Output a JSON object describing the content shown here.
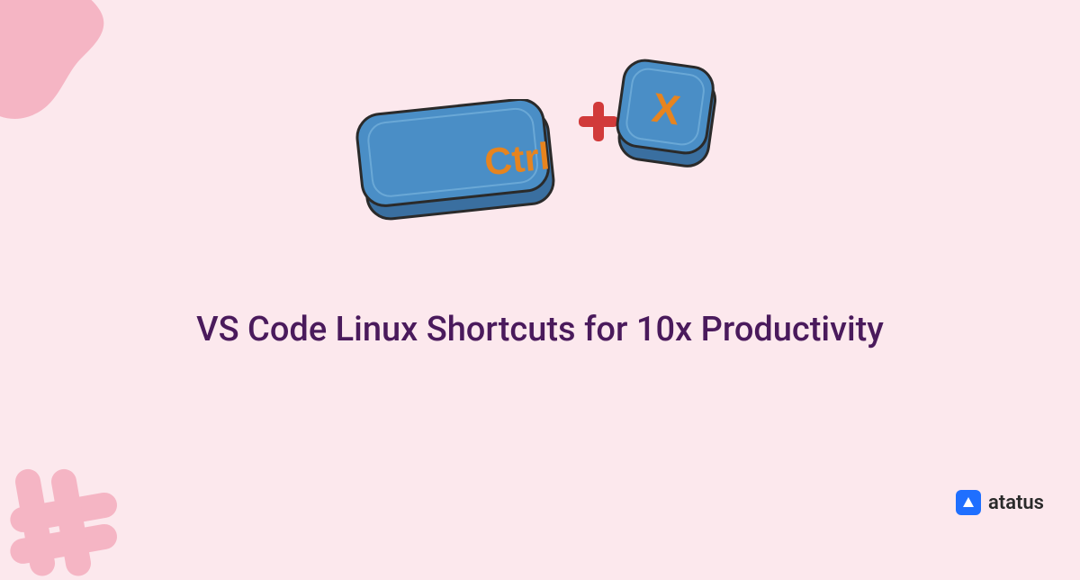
{
  "title": "VS Code Linux Shortcuts for 10x Productivity",
  "keys": {
    "ctrl_label": "Ctrl",
    "x_label": "X"
  },
  "brand": {
    "name": "atatus"
  },
  "colors": {
    "bg": "#fce8ed",
    "blob": "#f5b5c4",
    "key_fill": "#4a8ec6",
    "key_stroke": "#2a2a2a",
    "key_text": "#e6841f",
    "plus": "#d13a3a",
    "title": "#4a1a5c",
    "brand": "#1f6fff"
  }
}
